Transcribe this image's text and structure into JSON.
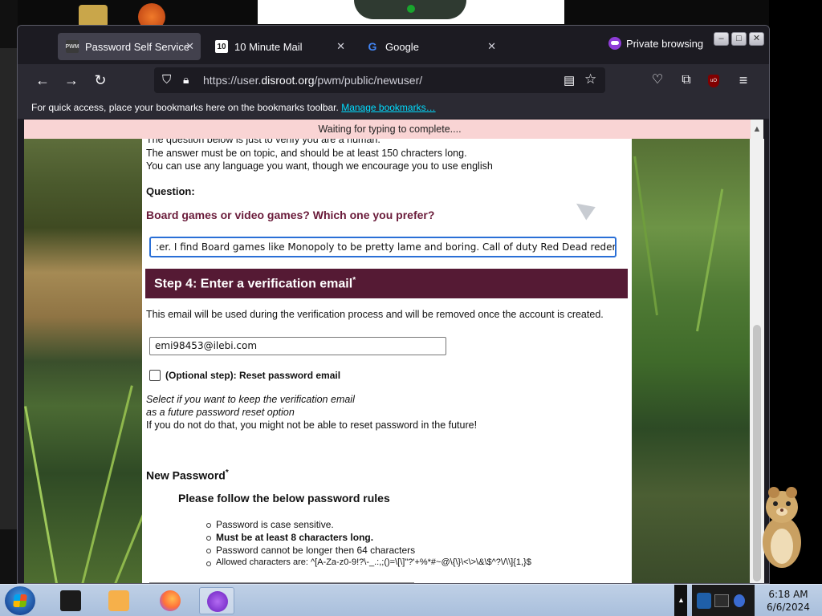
{
  "tabs": [
    {
      "label": "Password Self Service",
      "favicon": "PWM",
      "active": true
    },
    {
      "label": "10 Minute Mail",
      "favicon": "10",
      "active": false
    },
    {
      "label": "Google",
      "favicon": "G",
      "active": false
    }
  ],
  "private_label": "Private browsing",
  "url": {
    "prefix": "https://user.",
    "domain": "disroot.org",
    "path": "/pwm/public/newuser/"
  },
  "bookmarks": {
    "text": "For quick access, place your bookmarks here on the bookmarks toolbar.",
    "link": "Manage bookmarks…"
  },
  "notification": "Waiting for typing to complete....",
  "page": {
    "intro_lines": [
      "The question below is just to verify you are a human.",
      "The answer must be on topic, and should be at least 150 chracters long.",
      "You can use any language you want, though we encourage you to use english"
    ],
    "question_label": "Question:",
    "question": "Board games or video games? Which one you prefer?",
    "answer_value": ":er. I find Board games like Monopoly to be pretty lame and boring. Call of duty Red Dead redempeti",
    "step4_title": "Step 4: Enter a verification email",
    "step4_required": "*",
    "email_note": "This email will be used during the verification process and will be removed once the account is created.",
    "email_value": "emi98453@ilebi.com",
    "optional_label": "(Optional step): Reset password email",
    "optional_note_1": "Select if you want to keep the verification email",
    "optional_note_2": "as a future password reset option",
    "optional_warning": "If you do not do that, you might not be able to reset password in the future!",
    "new_password_label": "New Password",
    "new_password_required": "*",
    "rules_heading": "Please follow the below password rules",
    "rules": [
      {
        "text": "Password is case sensitive.",
        "bold": false
      },
      {
        "text": "Must be at least 8 characters long.",
        "bold": true
      },
      {
        "text": "Password cannot be longer then 64 characters",
        "bold": false
      },
      {
        "text": "Allowed characters are: ^[A-Za-z0-9!?\\-_.:,;()=\\[\\]\"?'+%*#~@\\{\\}\\<\\>\\&\\$^?\\/\\\\]{1,}$",
        "bold": false
      }
    ]
  },
  "taskbar": {
    "time": "6:18 AM",
    "date": "6/6/2024"
  },
  "colors": {
    "accent": "#551a34",
    "question": "#6a1b3a",
    "focus": "#2a6fd6",
    "notification_bg": "#f9d4d4"
  }
}
